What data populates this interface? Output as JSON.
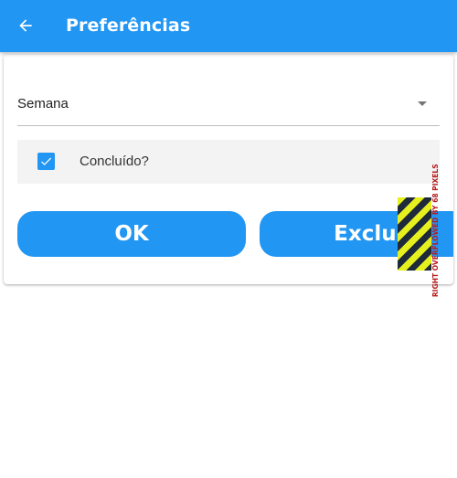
{
  "appbar": {
    "title": "Preferências",
    "back_icon": "arrow-back-icon"
  },
  "form": {
    "dropdown": {
      "value": "Semana",
      "icon": "dropdown-arrow-icon"
    },
    "checkbox": {
      "label": "Concluído?",
      "checked": true
    },
    "buttons": {
      "ok_label": "OK",
      "delete_label": "Excluir"
    }
  },
  "debug": {
    "overflow_text": "RIGHT OVERFLOWED BY 68 PIXELS"
  },
  "colors": {
    "primary": "#2196F3",
    "background": "#ffffff",
    "checkbox_row_bg": "#f3f3f3",
    "overflow_stripe_yellow": "#e5f01e",
    "overflow_stripe_dark": "#1e2a3a",
    "overflow_text": "#b71c1c"
  }
}
